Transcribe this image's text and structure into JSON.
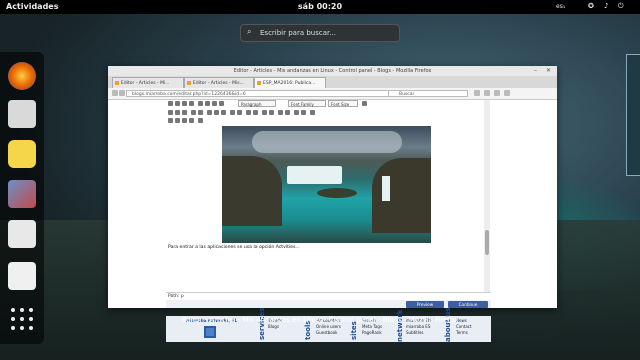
{
  "topbar": {
    "activities": "Actividades",
    "clock": "sáb 00:20",
    "language": "es₁"
  },
  "search": {
    "placeholder": "Escribir para buscar..."
  },
  "dock": {
    "apps": [
      {
        "name": "firefox-icon",
        "color": "#e66000"
      },
      {
        "name": "mail-client-icon",
        "color": "#d9d9d9"
      },
      {
        "name": "music-player-icon",
        "color": "#f5d54a"
      },
      {
        "name": "image-viewer-icon",
        "color": "#6d8fc7"
      },
      {
        "name": "file-manager-icon",
        "color": "#e8e8e8"
      },
      {
        "name": "software-center-icon",
        "color": "#f0f0f0"
      }
    ],
    "show_apps": "show-apps-grid-icon"
  },
  "window": {
    "title": "Editor - Articles - Mis andanzas en Linux - Control panel - Blogs - Mozilla Firefox",
    "tabs": [
      {
        "label": "Editor - Articles - Mi..."
      },
      {
        "label": "Editor - Articles - Mis..."
      },
      {
        "label": "ESP_MA2016: Publica..."
      }
    ],
    "url": "blogs.miarroba.com/editar.php?id=1226436&id=6",
    "search_placeholder": "Buscar",
    "editor": {
      "format_select": "Paragraph",
      "font_select": "Font Family",
      "size_select": "Font Size",
      "caption": "Para entrar a las aplicaciones se usa la opción Actvities...",
      "path": "Path: p",
      "preview_button": "Preview",
      "continue_button": "Continue"
    },
    "footer": {
      "brand": "miarroba networks, SL",
      "services_heading": "services",
      "services": [
        "Boards",
        "Blogs"
      ],
      "tools_heading": "tools",
      "tools": [
        "Hit counters",
        "Online users",
        "Guestbook"
      ],
      "sites_heading": "sites",
      "sites": [
        "Search",
        "Meta Tags",
        "PageRank"
      ],
      "network_heading": "network",
      "network": [
        "miarroba EN",
        "miarroba ES",
        "Subtitles"
      ],
      "about_heading": "about us",
      "about": [
        "News",
        "Contact",
        "Terms"
      ]
    }
  },
  "window_label": "Editor - Articles - Mis andanzas en Linux - Control panel - Blogs - Mozilla Firefox"
}
